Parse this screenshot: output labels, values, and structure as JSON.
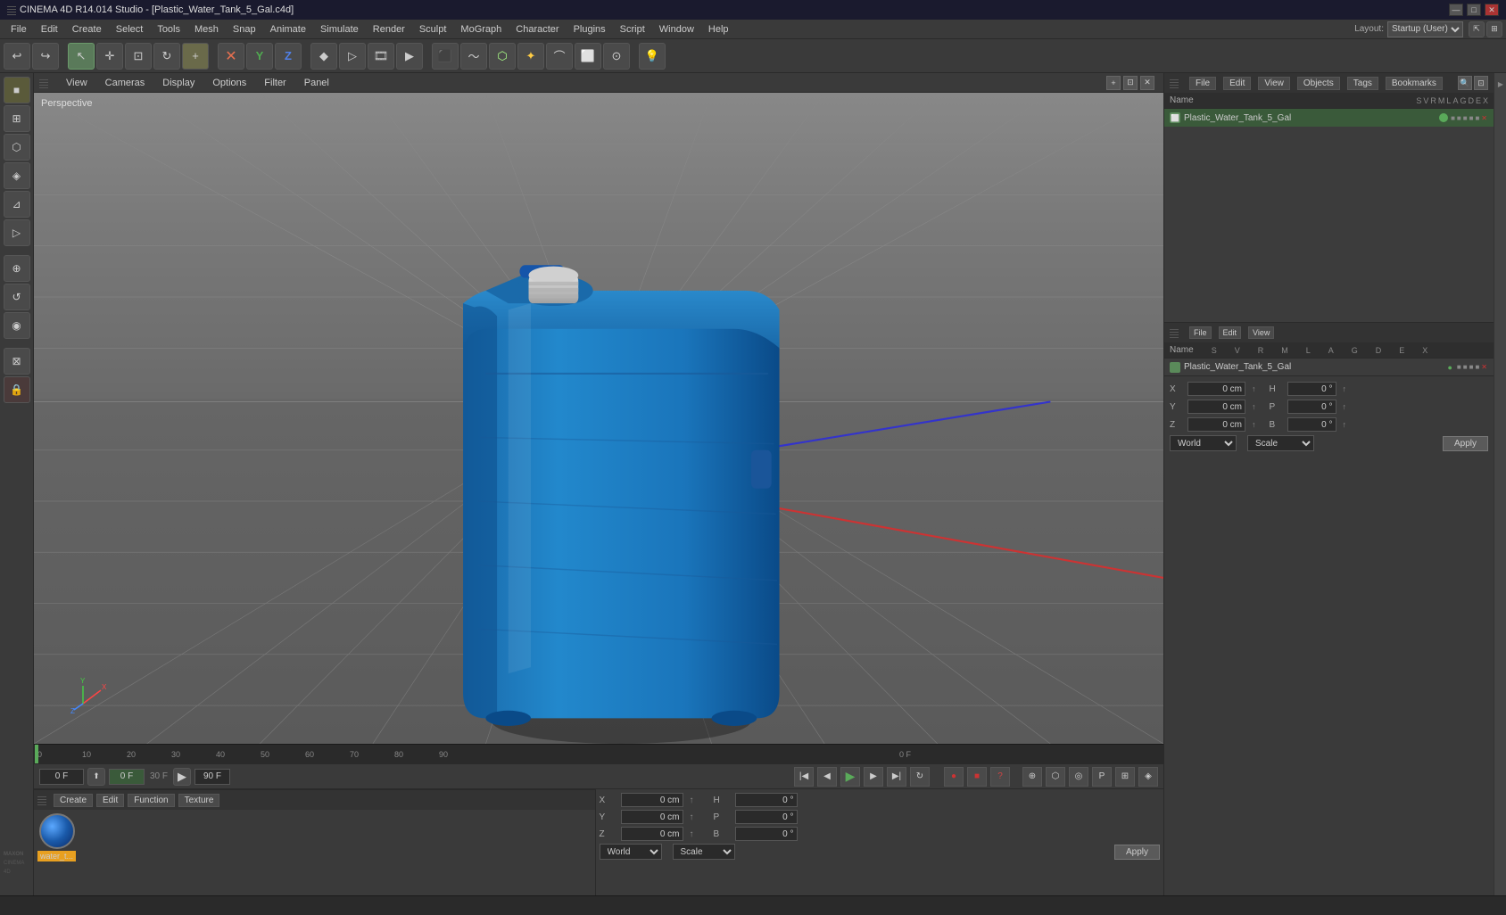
{
  "titlebar": {
    "title": "CINEMA 4D R14.014 Studio - [Plastic_Water_Tank_5_Gal.c4d]",
    "min_label": "—",
    "max_label": "□",
    "close_label": "✕"
  },
  "menubar": {
    "items": [
      "File",
      "Edit",
      "Create",
      "Select",
      "Tools",
      "Mesh",
      "Snap",
      "Animate",
      "Simulate",
      "Render",
      "Sculpt",
      "MoGraph",
      "Character",
      "Plugins",
      "Script",
      "Window",
      "Help"
    ]
  },
  "layout": {
    "label": "Layout:",
    "value": "Startup (User)"
  },
  "viewport": {
    "perspective_label": "Perspective",
    "menus": [
      "View",
      "Cameras",
      "Display",
      "Options",
      "Filter",
      "Panel"
    ]
  },
  "object_manager": {
    "title_menus": [
      "File",
      "Edit",
      "View",
      "Objects",
      "Tags",
      "Bookmarks"
    ],
    "toolbar_menus": [
      "File",
      "Edit",
      "View"
    ],
    "header": {
      "name_col": "Name",
      "flags": [
        "S",
        "V",
        "R",
        "M",
        "L",
        "A",
        "G",
        "D",
        "E",
        "X"
      ]
    },
    "objects": [
      {
        "name": "Plastic_Water_Tank_5_Gal",
        "icon": "mesh",
        "dot_color": "#5aaa5a"
      }
    ]
  },
  "attribute_manager": {
    "title_menus": [
      "File",
      "Edit",
      "View"
    ],
    "toolbar_menus": [
      "File",
      "Edit",
      "View"
    ],
    "header": {
      "name_col": "Name",
      "flags": [
        "S",
        "V",
        "R",
        "M",
        "L",
        "A",
        "G",
        "D",
        "E",
        "X"
      ]
    },
    "selected_object": "Plastic_Water_Tank_5_Gal",
    "coordinates": {
      "x_pos": "0 cm",
      "y_pos": "0 cm",
      "z_pos": "0 cm",
      "x_rot": "0 °",
      "y_rot": "0 °",
      "z_rot": "0 °",
      "h_val": "0 °",
      "p_val": "0 °",
      "b_val": "0 °"
    },
    "coord_fields": [
      {
        "label": "X",
        "pos_val": "0 cm",
        "suffix": "H",
        "rot_val": "0 °"
      },
      {
        "label": "Y",
        "pos_val": "0 cm",
        "suffix": "P",
        "rot_val": "0 °"
      },
      {
        "label": "Z",
        "pos_val": "0 cm",
        "suffix": "B",
        "rot_val": "0 °"
      }
    ],
    "dropdown1": "World",
    "dropdown2": "Scale",
    "apply_button": "Apply"
  },
  "material_area": {
    "toolbar_menus": [
      "Create",
      "Edit",
      "Function",
      "Texture"
    ],
    "materials": [
      {
        "name": "water_t...",
        "sphere_color": "#1a5aaa"
      }
    ]
  },
  "timeline": {
    "current_frame": "0",
    "frame_label": "0 F",
    "fps_label": "30 F",
    "end_frame": "90 F",
    "start_label": "0 F",
    "end_label": "0 F",
    "markers": [
      0,
      10,
      20,
      30,
      40,
      50,
      60,
      70,
      80,
      90
    ]
  },
  "icons": {
    "undo": "↩",
    "redo": "↪",
    "select": "↖",
    "move": "✛",
    "scale": "⊡",
    "rotate": "↻",
    "plus": "+",
    "circle": "○",
    "cross": "✕",
    "y_axis": "Y",
    "z_axis": "Z",
    "keyframe": "◆",
    "render": "▷",
    "camera": "📷",
    "play": "▶",
    "stop": "■",
    "rewind": "◀◀",
    "forward": "▶▶",
    "end": "▶|",
    "record": "●"
  },
  "statusbar": {
    "text": ""
  }
}
